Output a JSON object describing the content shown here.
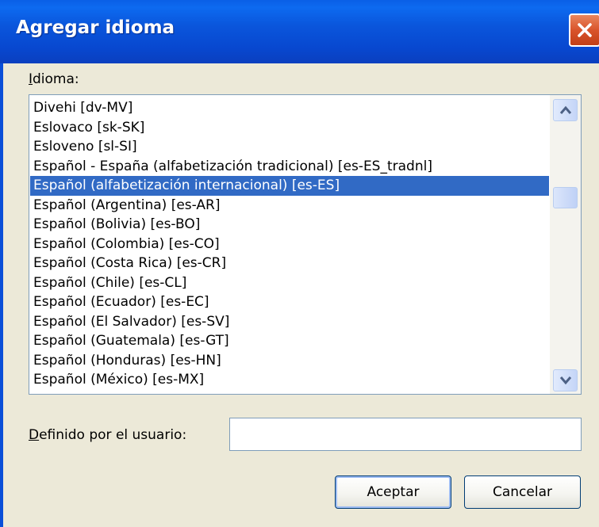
{
  "window": {
    "title": "Agregar idioma"
  },
  "language_label": "Idioma:",
  "languages": [
    "Divehi [dv-MV]",
    "Eslovaco [sk-SK]",
    "Esloveno [sl-SI]",
    "Español - España (alfabetización tradicional) [es-ES_tradnl]",
    "Español (alfabetización internacional) [es-ES]",
    "Español (Argentina) [es-AR]",
    "Español (Bolivia) [es-BO]",
    "Español (Colombia) [es-CO]",
    "Español (Costa Rica) [es-CR]",
    "Español (Chile) [es-CL]",
    "Español (Ecuador) [es-EC]",
    "Español (El Salvador) [es-SV]",
    "Español (Guatemala) [es-GT]",
    "Español (Honduras) [es-HN]",
    "Español (México) [es-MX]"
  ],
  "selected_language": "Español (alfabetización internacional) [es-ES]",
  "user_defined_label": "Definido por el usuario:",
  "user_defined_value": "",
  "buttons": {
    "ok": "Aceptar",
    "cancel": "Cancelar"
  },
  "icons": {
    "close": "close-icon",
    "scroll_up": "arrow-up-icon",
    "scroll_down": "arrow-down-icon"
  },
  "colors": {
    "titlebar": "#0A56DC",
    "selection": "#316AC5",
    "dialog_bg": "#ECE9D8",
    "close_button": "#D9542B"
  }
}
